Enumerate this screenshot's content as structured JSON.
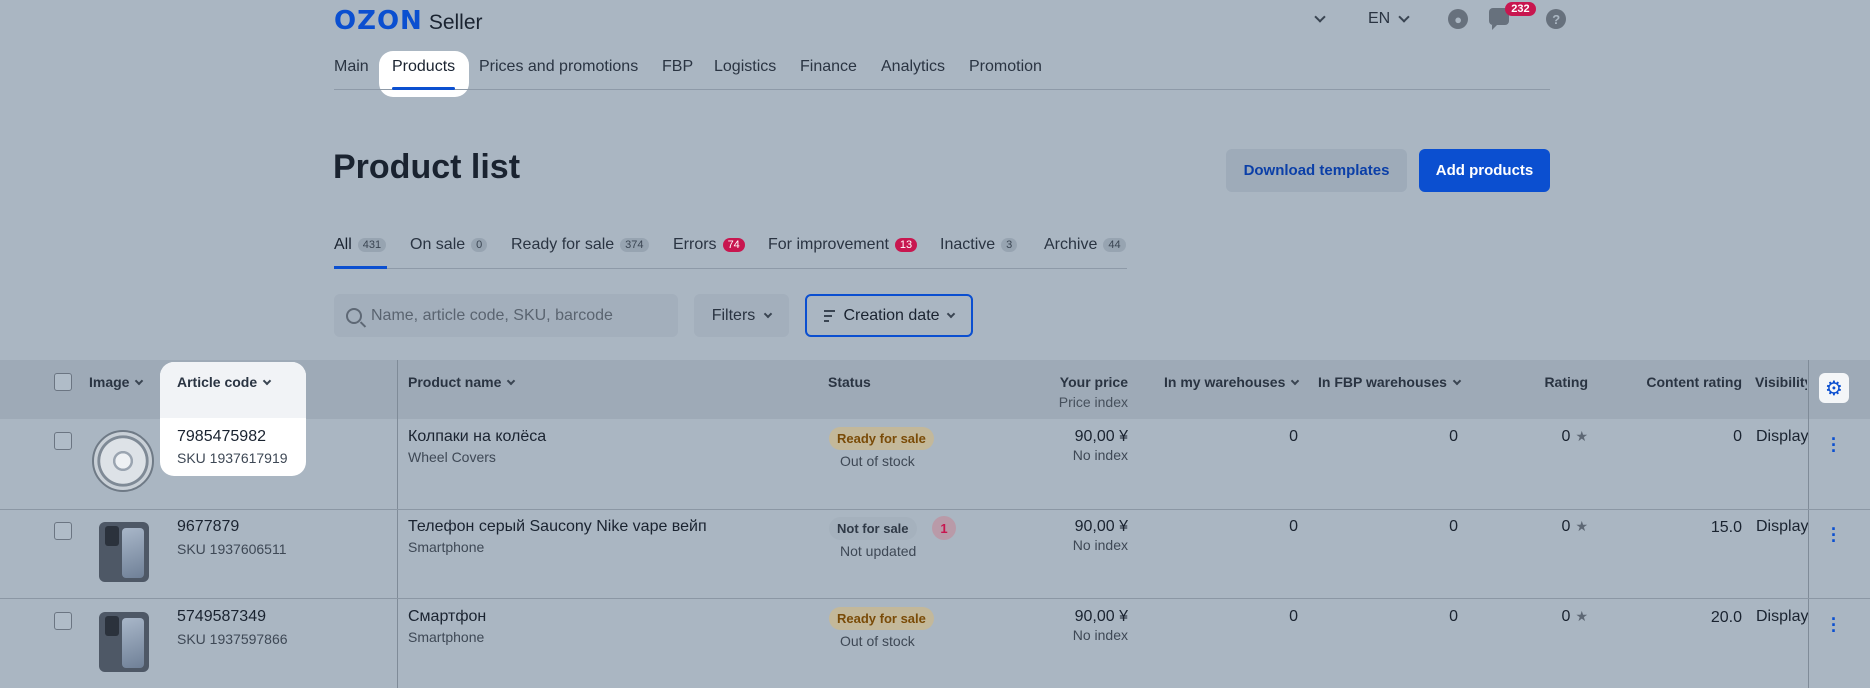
{
  "header": {
    "logo_brand": "OZON",
    "logo_product": "Seller",
    "language": "EN",
    "notifications_count": "232",
    "help_glyph": "?"
  },
  "nav": {
    "items": [
      "Main",
      "Products",
      "Prices and promotions",
      "FBP",
      "Logistics",
      "Finance",
      "Analytics",
      "Promotion"
    ],
    "active": "Products"
  },
  "page": {
    "title": "Product list",
    "download_templates": "Download templates",
    "add_products": "Add products"
  },
  "tabs": [
    {
      "label": "All",
      "count": "431"
    },
    {
      "label": "On sale",
      "count": "0"
    },
    {
      "label": "Ready for sale",
      "count": "374"
    },
    {
      "label": "Errors",
      "count": "74"
    },
    {
      "label": "For improvement",
      "count": "13"
    },
    {
      "label": "Inactive",
      "count": "3"
    },
    {
      "label": "Archive",
      "count": "44"
    }
  ],
  "toolbar": {
    "search_placeholder": "Name, article code, SKU, barcode",
    "filters_label": "Filters",
    "sort_label": "Creation date"
  },
  "table": {
    "columns": {
      "image": "Image",
      "article_code": "Article code",
      "product_name": "Product name",
      "status": "Status",
      "your_price": "Your price",
      "price_index": "Price index",
      "in_my_warehouses": "In my warehouses",
      "in_fbp_warehouses": "In FBP warehouses",
      "rating": "Rating",
      "content_rating": "Content rating",
      "visibility": "Visibility"
    },
    "rows": [
      {
        "article": "7985475982",
        "sku": "SKU 1937617919",
        "name": "Колпаки на колёса",
        "category": "Wheel Covers",
        "status": "Ready for sale",
        "status_sub": "Out of stock",
        "errors": "",
        "price": "90,00 ¥",
        "price_index": "No index",
        "my_wh": "0",
        "fbp_wh": "0",
        "rating": "0",
        "content_rating": "0",
        "visibility": "Display"
      },
      {
        "article": "9677879",
        "sku": "SKU 1937606511",
        "name": "Телефон серый Saucony Nike vape вейп",
        "category": "Smartphone",
        "status": "Not for sale",
        "status_sub": "Not updated",
        "errors": "1",
        "price": "90,00 ¥",
        "price_index": "No index",
        "my_wh": "0",
        "fbp_wh": "0",
        "rating": "0",
        "content_rating": "15.0",
        "visibility": "Display"
      },
      {
        "article": "5749587349",
        "sku": "SKU 1937597866",
        "name": "Смартфон",
        "category": "Smartphone",
        "status": "Ready for sale",
        "status_sub": "Out of stock",
        "errors": "",
        "price": "90,00 ¥",
        "price_index": "No index",
        "my_wh": "0",
        "fbp_wh": "0",
        "rating": "0",
        "content_rating": "20.0",
        "visibility": "Display"
      }
    ]
  },
  "icons": {
    "settings": "gear-icon",
    "row_menu": "more-vertical-icon",
    "rating": "star-icon"
  },
  "colors": {
    "accent": "#0b4fd0",
    "error": "#c8164f",
    "ready_text": "#7a4b07"
  }
}
